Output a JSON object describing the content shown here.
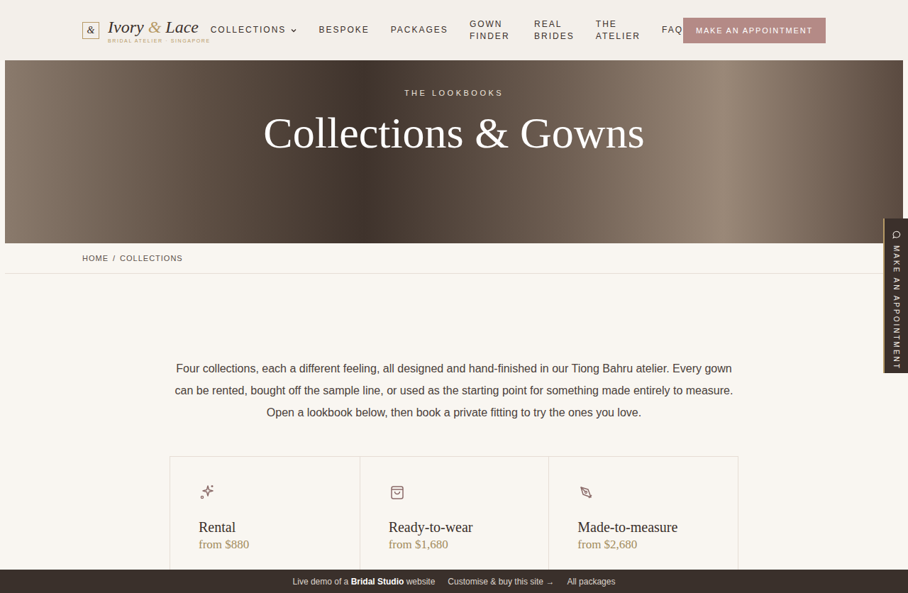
{
  "header": {
    "logo": {
      "mark": "&",
      "name_start": "Ivory",
      "ampersand": "&",
      "name_end": "Lace",
      "tagline": "BRIDAL ATELIER · SINGAPORE"
    },
    "nav": [
      {
        "label": "COLLECTIONS",
        "dropdown": true
      },
      {
        "label": "BESPOKE",
        "dropdown": false
      },
      {
        "label": "PACKAGES",
        "dropdown": false
      },
      {
        "label": "GOWN FINDER",
        "dropdown": false
      },
      {
        "label": "REAL BRIDES",
        "dropdown": false
      },
      {
        "label": "THE ATELIER",
        "dropdown": false
      },
      {
        "label": "FAQ",
        "dropdown": false
      }
    ],
    "cta": "MAKE AN APPOINTMENT"
  },
  "hero": {
    "eyebrow": "THE LOOKBOOKS",
    "title": "Collections & Gowns"
  },
  "breadcrumb": {
    "items": [
      "HOME",
      "COLLECTIONS"
    ],
    "separator": "/"
  },
  "intro": "Four collections, each a different feeling, all designed and hand-finished in our Tiong Bahru atelier. Every gown can be rented, bought off the sample line, or used as the starting point for something made entirely to measure. Open a lookbook below, then book a private fitting to try the ones you love.",
  "options": [
    {
      "kind": "sparkle",
      "title": "Rental",
      "price": "from $880"
    },
    {
      "kind": "bag",
      "title": "Ready-to-wear",
      "price": "from $1,680"
    },
    {
      "kind": "pen",
      "title": "Made-to-measure",
      "price": "from $2,680"
    }
  ],
  "side_tab": {
    "label": "MAKE AN APPOINTMENT"
  },
  "demo_bar": {
    "prefix": "Live demo of a",
    "brand": "Bridal Studio",
    "suffix": "website",
    "customise": "Customise & buy this site →",
    "packages": "All packages"
  }
}
